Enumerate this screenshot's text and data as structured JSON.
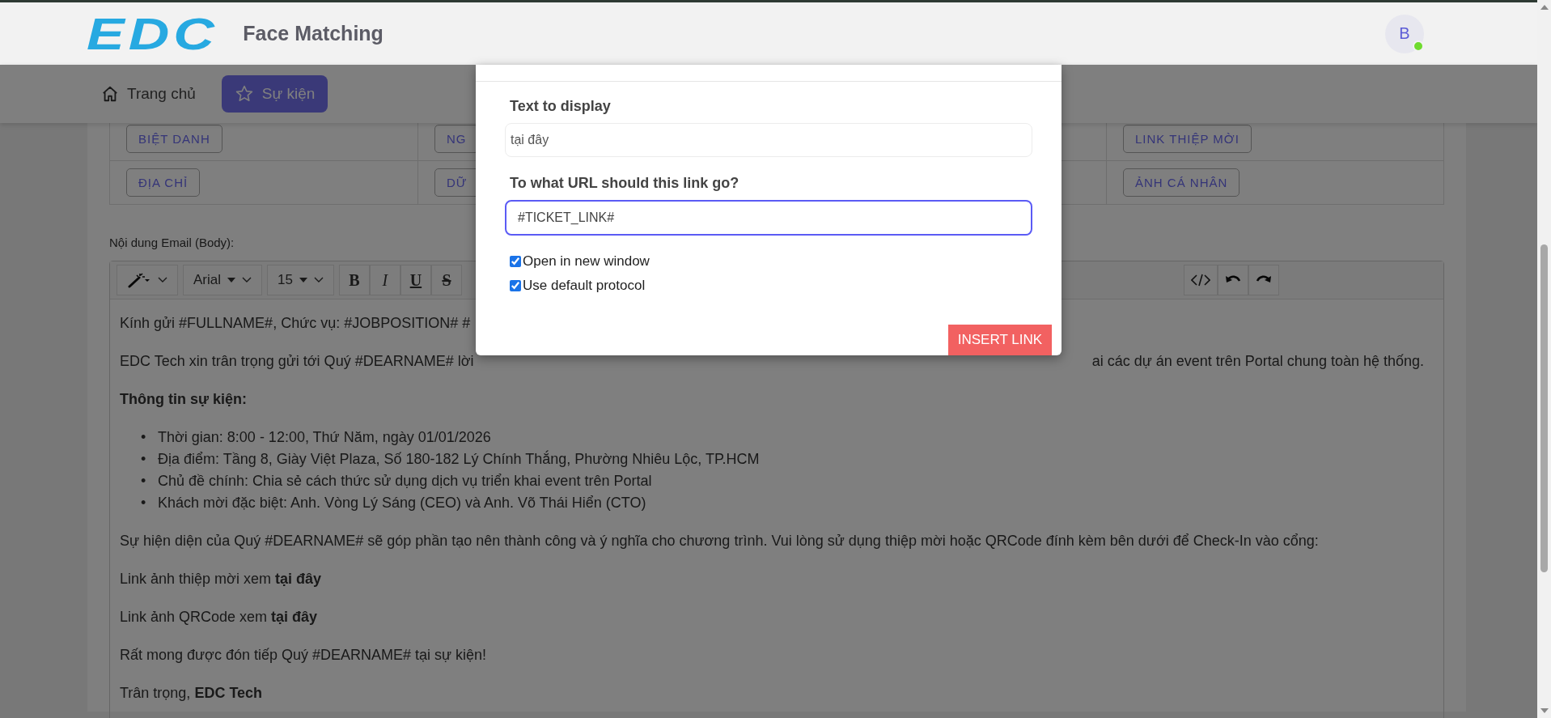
{
  "header": {
    "logo": "EDC",
    "app_name": "Face Matching",
    "avatar": {
      "initial": "B",
      "online": true
    }
  },
  "nav": [
    {
      "label": "Trang chủ",
      "selected": false
    },
    {
      "label": "Sự kiện",
      "selected": true
    }
  ],
  "variables": [
    {
      "cells": [
        "BIỆT DANH",
        "NG",
        null,
        "LINK THIỆP MỜI"
      ]
    },
    {
      "cells": [
        "ĐỊA CHỈ",
        "DỮ",
        null,
        "ẢNH CÁ NHÂN"
      ]
    }
  ],
  "editor": {
    "label": "Nội dung Email (Body):",
    "font": "Arial",
    "size": "15",
    "format_buttons": [
      "B",
      "I",
      "U",
      "S"
    ],
    "paragraphs": [
      {
        "kind": "text",
        "parts": [
          "Kính gửi #FULLNAME#, Chức vụ: #JOBPOSITION# #"
        ]
      },
      {
        "kind": "text",
        "parts": [
          "EDC Tech xin trân trọng gửi tới Quý #DEARNAME# lời",
          "ai các dự án event trên Portal chung toàn hệ thống."
        ]
      },
      {
        "kind": "heading",
        "text": "Thông tin sự kiện:"
      },
      {
        "kind": "list",
        "marker": "•",
        "items": [
          "Thời gian: 8:00 - 12:00, Thứ Năm, ngày 01/01/2026",
          "Địa điểm: Tầng 8, Giày Việt Plaza, Số 180-182 Lý Chính Thắng, Phường Nhiêu Lộc, TP.HCM",
          "Chủ đề chính: Chia sẻ cách thức sử dụng dịch vụ triển khai event trên Portal",
          "Khách mời đặc biệt: Anh. Vòng Lý Sáng (CEO) và Anh. Võ Thái Hiển (CTO)"
        ]
      },
      {
        "kind": "text",
        "parts": [
          "Sự hiện diện của Quý #DEARNAME# sẽ góp phần tạo nên thành công và ý nghĩa cho chương trình. Vui lòng sử dụng thiệp mời hoặc QRCode đính kèm bên dưới để Check-In vào cổng:"
        ]
      },
      {
        "kind": "text",
        "parts": [
          "Link ảnh thiệp mời xem **tại đây**"
        ]
      },
      {
        "kind": "text",
        "parts": [
          "Link ảnh QRCode xem **tại đây**"
        ]
      },
      {
        "kind": "text",
        "parts": [
          "Rất mong được đón tiếp Quý #DEARNAME# tại sự kiện!"
        ]
      },
      {
        "kind": "text",
        "parts": [
          "Trân trọng, **EDC Tech**"
        ]
      }
    ]
  },
  "dialog": {
    "fields": [
      {
        "label": "Text to display",
        "value": "tại đây",
        "focused": false
      },
      {
        "label": "To what URL should this link go?",
        "value": "#TICKET_LINK#",
        "focused": true
      }
    ],
    "options": [
      {
        "label": "Open in new window",
        "checked": true
      },
      {
        "label": "Use default protocol",
        "checked": true
      }
    ],
    "button": "INSERT LINK"
  }
}
